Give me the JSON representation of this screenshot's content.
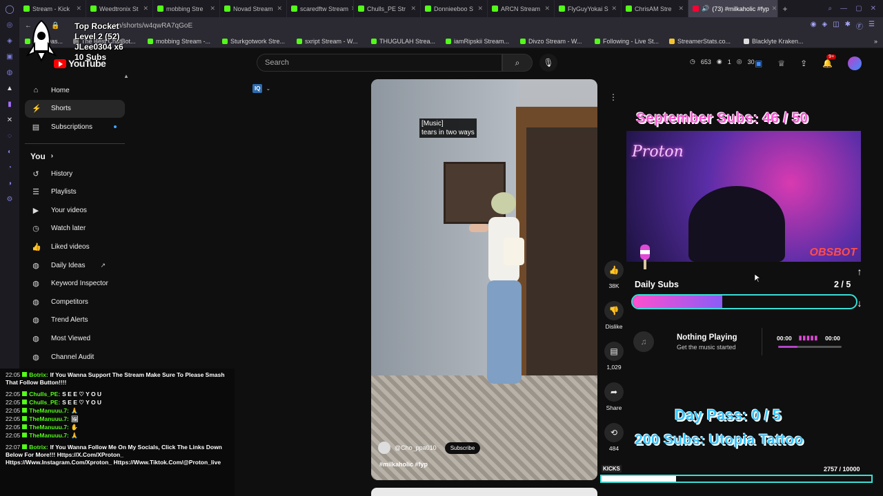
{
  "browser": {
    "tabs": [
      {
        "label": "Stream - Kick"
      },
      {
        "label": "Weedtronix St"
      },
      {
        "label": "mobbing Stre"
      },
      {
        "label": "Novad Stream"
      },
      {
        "label": "scaredftw Stream"
      },
      {
        "label": "Chulls_PE Str"
      },
      {
        "label": "Donnieeboo S"
      },
      {
        "label": "ARCN Stream"
      },
      {
        "label": "FlyGuyYokai S"
      },
      {
        "label": "ChrisAM Stre"
      }
    ],
    "active_tab": "(73) #milkaholic #fyp",
    "url": "com/shorts/w4qwRA7qGoE",
    "bookmarks": [
      "The Best ChatBot...",
      "mobbing Stream -...",
      "Sturkgotwork Stre...",
      "sxript Stream - W...",
      "THUGULAH Strea...",
      "iamRipskii Stream...",
      "Divzo Stream - W...",
      "Following - Live St...",
      "StreamerStats.co...",
      "Blacklyte Kraken..."
    ]
  },
  "overlay": {
    "rocket_title": "Top Rocket",
    "rocket_level": "Level 2  (52)",
    "rocket_user": "JLee0304 x6",
    "rocket_subs": "10 Subs"
  },
  "header": {
    "logo_text": "YouTube",
    "search_placeholder": "Search",
    "stat_a": "653",
    "stat_b": "1",
    "stat_c": "30",
    "notif_count": "9+"
  },
  "sidebar": {
    "top": [
      {
        "label": "Home",
        "icon": "home-icon"
      },
      {
        "label": "Shorts",
        "icon": "shorts-icon"
      },
      {
        "label": "Subscriptions",
        "icon": "subscriptions-icon"
      }
    ],
    "you_label": "You",
    "you_items": [
      {
        "label": "History"
      },
      {
        "label": "Playlists"
      },
      {
        "label": "Your videos"
      },
      {
        "label": "Watch later"
      },
      {
        "label": "Liked videos"
      },
      {
        "label": "Daily Ideas"
      },
      {
        "label": "Keyword Inspector"
      },
      {
        "label": "Competitors"
      },
      {
        "label": "Trend Alerts"
      },
      {
        "label": "Most Viewed"
      },
      {
        "label": "Channel Audit"
      }
    ]
  },
  "chat": [
    {
      "time": "22:05",
      "user": "Botrix:",
      "msg": "If You Wanna Support The Stream Make Sure To Please Smash That Follow Button!!!!"
    },
    {
      "time": "22:05",
      "user": "Chulls_PE:",
      "msg": "S E E ♡ Y O U"
    },
    {
      "time": "22:05",
      "user": "Chulls_PE:",
      "msg": "S E E ♡ Y O U"
    },
    {
      "time": "22:05",
      "user": "TheManuuu.7:",
      "msg": ""
    },
    {
      "time": "22:05",
      "user": "TheManuuu.7:",
      "msg": ""
    },
    {
      "time": "22:05",
      "user": "TheManuuu.7:",
      "msg": ""
    },
    {
      "time": "22:05",
      "user": "TheManuuu.7:",
      "msg": ""
    },
    {
      "time": "22:07",
      "user": "Botrix:",
      "msg": "If You Wanna Follow Me On My Socials, Click The Links Down Below For More!!! Https://X.Com/XProton_ Https://Www.Instagram.Com/Xproton_ Https://Www.Tiktok.Com/@Proton_live"
    }
  ],
  "video": {
    "caption_line1": "[Music]",
    "caption_line2": "tears in two ways",
    "channel": "@Cho_ppa010",
    "subscribe_label": "Subscribe",
    "hashtags": "#milkaholic #fyp"
  },
  "actions": {
    "likes": "38K",
    "dislike_label": "Dislike",
    "comments": "1,029",
    "share_label": "Share",
    "remix": "484"
  },
  "stream": {
    "september_goal": "September Subs: 46 / 50",
    "cam_sign": "Proton",
    "cam_brand": "OBSBOT",
    "daily_subs_label": "Daily Subs",
    "daily_subs_count": "2 / 5",
    "daily_subs_fraction": 0.4,
    "music_title": "Nothing Playing",
    "music_sub": "Get the music started",
    "music_time_start": "00:00",
    "music_time_end": "00:00",
    "day_pass": "Day Pass: 0 / 5",
    "utopia": "200 Subs: Utopia Tattoo",
    "kicks_label": "KICKS",
    "kicks_count": "2757  / 10000",
    "kicks_fraction": 0.2757
  },
  "colors": {
    "kick_green": "#53fc18",
    "youtube_red": "#ff0000",
    "overlay_pink": "#ff5ad8",
    "overlay_cyan": "#3ac6ff"
  }
}
